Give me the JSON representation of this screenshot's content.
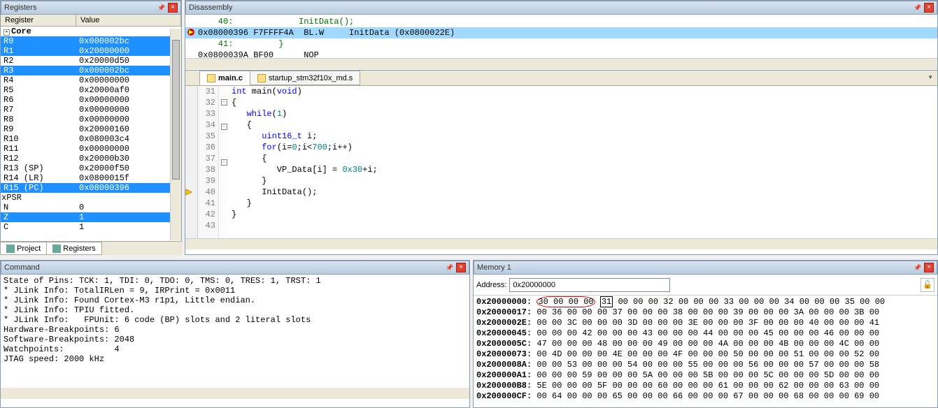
{
  "panels": {
    "registers": {
      "title": "Registers",
      "col_name": "Register",
      "col_value": "Value"
    },
    "disassembly": {
      "title": "Disassembly"
    },
    "command": {
      "title": "Command"
    },
    "memory": {
      "title": "Memory 1",
      "address_label": "Address:",
      "address_value": "0x20000000"
    }
  },
  "registers": {
    "group": "Core",
    "items": [
      {
        "name": "R0",
        "value": "0x000002bc",
        "sel": true
      },
      {
        "name": "R1",
        "value": "0x20000000",
        "sel": true
      },
      {
        "name": "R2",
        "value": "0x20000d50",
        "sel": false
      },
      {
        "name": "R3",
        "value": "0x000002bc",
        "sel": true
      },
      {
        "name": "R4",
        "value": "0x00000000",
        "sel": false
      },
      {
        "name": "R5",
        "value": "0x20000af0",
        "sel": false
      },
      {
        "name": "R6",
        "value": "0x00000000",
        "sel": false
      },
      {
        "name": "R7",
        "value": "0x00000000",
        "sel": false
      },
      {
        "name": "R8",
        "value": "0x00000000",
        "sel": false
      },
      {
        "name": "R9",
        "value": "0x20000160",
        "sel": false
      },
      {
        "name": "R10",
        "value": "0x080003c4",
        "sel": false
      },
      {
        "name": "R11",
        "value": "0x00000000",
        "sel": false
      },
      {
        "name": "R12",
        "value": "0x20000b30",
        "sel": false
      },
      {
        "name": "R13 (SP)",
        "value": "0x20000f50",
        "sel": false
      },
      {
        "name": "R14 (LR)",
        "value": "0x0800015f",
        "sel": false
      },
      {
        "name": "R15 (PC)",
        "value": "0x08000396",
        "sel": true
      },
      {
        "name": "xPSR",
        "value": "",
        "sel": false,
        "expandable": true
      }
    ],
    "flags": [
      {
        "name": "N",
        "value": "0",
        "sel": false
      },
      {
        "name": "Z",
        "value": "1",
        "sel": true
      },
      {
        "name": "C",
        "value": "1",
        "sel": false
      }
    ]
  },
  "reg_tabs": [
    {
      "label": "Project",
      "icon": "project-icon"
    },
    {
      "label": "Registers",
      "icon": "registers-icon"
    }
  ],
  "disassembly": [
    {
      "text": "    40:             InitData();",
      "cls": "disasm-comment",
      "icon": ""
    },
    {
      "text": "0x08000396 F7FFFF4A  BL.W     InitData (0x0800022E)",
      "cls": "disasm-hl",
      "icon": "bp"
    },
    {
      "text": "    41:         }",
      "cls": "disasm-comment",
      "icon": ""
    },
    {
      "text": "0x0800039A BF00      NOP",
      "cls": "",
      "icon": ""
    }
  ],
  "editor": {
    "tabs": [
      {
        "label": "main.c",
        "active": true
      },
      {
        "label": "startup_stm32f10x_md.s",
        "active": false
      }
    ],
    "lines": [
      {
        "n": 31,
        "code": "int main(void)",
        "fold": "",
        "icon": ""
      },
      {
        "n": 32,
        "code": "{",
        "fold": "-",
        "icon": ""
      },
      {
        "n": 33,
        "code": "   while(1)",
        "fold": "",
        "icon": ""
      },
      {
        "n": 34,
        "code": "   {",
        "fold": "-",
        "icon": ""
      },
      {
        "n": 35,
        "code": "      uint16_t i;",
        "fold": "",
        "icon": ""
      },
      {
        "n": 36,
        "code": "      for(i=0;i<700;i++)",
        "fold": "",
        "icon": ""
      },
      {
        "n": 37,
        "code": "      {",
        "fold": "-",
        "icon": ""
      },
      {
        "n": 38,
        "code": "         VP_Data[i] = 0x30+i;",
        "fold": "",
        "icon": ""
      },
      {
        "n": 39,
        "code": "      }",
        "fold": "",
        "icon": ""
      },
      {
        "n": 40,
        "code": "      InitData();",
        "fold": "",
        "icon": "pc"
      },
      {
        "n": 41,
        "code": "   }",
        "fold": "",
        "icon": ""
      },
      {
        "n": 42,
        "code": "}",
        "fold": "",
        "icon": ""
      },
      {
        "n": 43,
        "code": "",
        "fold": "",
        "icon": ""
      }
    ]
  },
  "command_lines": [
    "State of Pins: TCK: 1, TDI: 0, TDO: 0, TMS: 0, TRES: 1, TRST: 1",
    "* JLink Info: TotalIRLen = 9, IRPrint = 0x0011",
    "* JLink Info: Found Cortex-M3 r1p1, Little endian.",
    "* JLink Info: TPIU fitted.",
    "* JLink Info:   FPUnit: 6 code (BP) slots and 2 literal slots",
    "Hardware-Breakpoints: 6",
    "Software-Breakpoints: 2048",
    "Watchpoints:          4",
    "JTAG speed: 2000 kHz"
  ],
  "memory": [
    {
      "addr": "0x20000000:",
      "bytes": "30 00 00 00 31 00 00 00 32 00 00 00 33 00 00 00 34 00 00 00 35 00 00",
      "mark": true
    },
    {
      "addr": "0x20000017:",
      "bytes": "00 36 00 00 00 37 00 00 00 38 00 00 00 39 00 00 00 3A 00 00 00 3B 00"
    },
    {
      "addr": "0x2000002E:",
      "bytes": "00 00 3C 00 00 00 3D 00 00 00 3E 00 00 00 3F 00 00 00 40 00 00 00 41"
    },
    {
      "addr": "0x20000045:",
      "bytes": "00 00 00 42 00 00 00 43 00 00 00 44 00 00 00 45 00 00 00 46 00 00 00"
    },
    {
      "addr": "0x2000005C:",
      "bytes": "47 00 00 00 48 00 00 00 49 00 00 00 4A 00 00 00 4B 00 00 00 4C 00 00"
    },
    {
      "addr": "0x20000073:",
      "bytes": "00 4D 00 00 00 4E 00 00 00 4F 00 00 00 50 00 00 00 51 00 00 00 52 00"
    },
    {
      "addr": "0x2000008A:",
      "bytes": "00 00 53 00 00 00 54 00 00 00 55 00 00 00 56 00 00 00 57 00 00 00 58"
    },
    {
      "addr": "0x200000A1:",
      "bytes": "00 00 00 59 00 00 00 5A 00 00 00 5B 00 00 00 5C 00 00 00 5D 00 00 00"
    },
    {
      "addr": "0x200000B8:",
      "bytes": "5E 00 00 00 5F 00 00 00 60 00 00 00 61 00 00 00 62 00 00 00 63 00 00"
    },
    {
      "addr": "0x200000CF:",
      "bytes": "00 64 00 00 00 65 00 00 00 66 00 00 00 67 00 00 00 68 00 00 00 69 00"
    }
  ]
}
